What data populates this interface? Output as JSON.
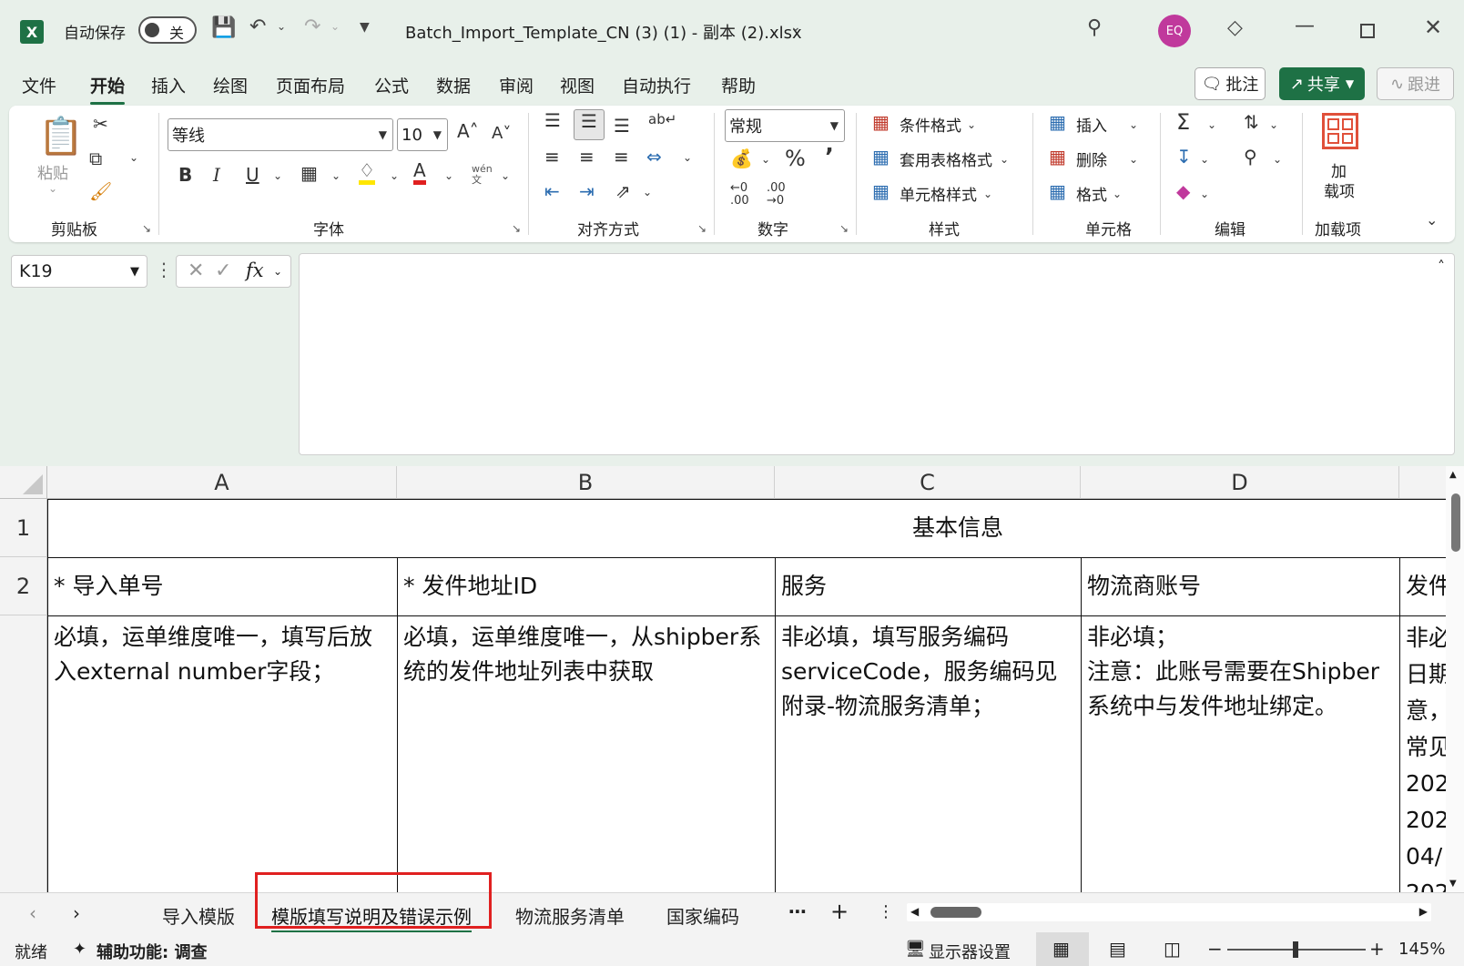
{
  "titlebar": {
    "app_icon": "excel-logo",
    "autosave_label": "自动保存",
    "autosave_state": "关",
    "document_title": "Batch_Import_Template_CN (3) (1) - 副本 (2).xlsx",
    "avatar_initials": "EQ"
  },
  "menu": {
    "tabs": [
      "文件",
      "开始",
      "插入",
      "绘图",
      "页面布局",
      "公式",
      "数据",
      "审阅",
      "视图",
      "自动执行",
      "帮助"
    ],
    "active": "开始",
    "comment_label": "批注",
    "share_label": "共享",
    "follow_label": "跟进"
  },
  "ribbon": {
    "clipboard": {
      "paste_label": "粘贴",
      "group": "剪贴板"
    },
    "font": {
      "font_name": "等线",
      "font_size": "10",
      "group": "字体",
      "phonetic": "wén"
    },
    "alignment": {
      "group": "对齐方式"
    },
    "number": {
      "format": "常规",
      "group": "数字"
    },
    "styles": {
      "conditional": "条件格式",
      "table": "套用表格格式",
      "cell_style": "单元格样式",
      "group": "样式"
    },
    "cells": {
      "insert": "插入",
      "delete": "删除",
      "format": "格式",
      "group": "单元格"
    },
    "editing": {
      "group": "编辑"
    },
    "addins": {
      "label_line1": "加",
      "label_line2": "载项",
      "group": "加载项"
    }
  },
  "formula_bar": {
    "name_box": "K19",
    "fx": "fx",
    "content": ""
  },
  "grid": {
    "columns": [
      "A",
      "B",
      "C",
      "D"
    ],
    "rows": [
      "1",
      "2"
    ],
    "title": "基本信息",
    "headers": [
      "* 导入单号",
      "* 发件地址ID",
      "服务",
      "物流商账号",
      "发件"
    ],
    "descriptions": [
      "必填，运单维度唯一，填写后放入external number字段；",
      "必填，运单维度唯一，从shipber系统的发件地址列表中获取",
      "非必填，填写服务编码serviceCode，服务编码见附录-物流服务清单；",
      "非必填；\n注意：此账号需要在Shipber系统中与发件地址绑定。",
      "非必\n日期\n意，\n常见\n202\n202\n04/\n202"
    ]
  },
  "sheets": {
    "tabs": [
      "导入模版",
      "模版填写说明及错误示例",
      "物流服务清单",
      "国家编码"
    ],
    "active": "模版填写说明及错误示例"
  },
  "statusbar": {
    "ready": "就绪",
    "accessibility": "辅助功能: 调查",
    "display_settings": "显示器设置",
    "zoom": "145%"
  },
  "colors": {
    "accent": "#1e7145",
    "avatar": "#c0399c",
    "highlight_box": "#e02020",
    "warning_text": "#e0303a"
  }
}
